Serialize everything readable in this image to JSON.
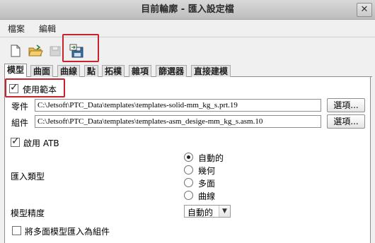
{
  "window": {
    "title": "目前輪廓 - 匯入設定檔",
    "close_glyph": "✕"
  },
  "menu": {
    "items": [
      "檔案",
      "編輯"
    ]
  },
  "toolbar": {
    "buttons": [
      "new-file-icon",
      "open-folder-icon",
      "save-icon",
      "save-as-icon"
    ]
  },
  "tabs": [
    "模型",
    "曲面",
    "曲線",
    "點",
    "拓樸",
    "雜項",
    "篩選器",
    "直接建模"
  ],
  "use_template": {
    "label": "使用範本",
    "checked": true
  },
  "templates": {
    "part": {
      "label": "零件",
      "value": "C:\\Jetsoft\\PTC_Data\\templates\\templates-solid-mm_kg_s.prt.19",
      "button": "選項..."
    },
    "assembly": {
      "label": "組件",
      "value": "C:\\Jetsoft\\PTC_Data\\templates\\templates-asm_desige-mm_kg_s.asm.10",
      "button": "選項..."
    }
  },
  "enable_atb": {
    "label": "啟用 ATB",
    "checked": true
  },
  "import_type": {
    "label": "匯入類型",
    "options": [
      "自動的",
      "幾何",
      "多面",
      "曲線"
    ],
    "selected": "自動的"
  },
  "model_accuracy": {
    "label": "模型精度",
    "value": "自動的",
    "arrow": "▼"
  },
  "import_facets_as_assembly": {
    "label": "將多面模型匯入為組件",
    "checked": false
  },
  "colors": {
    "highlight": "#c8232c"
  }
}
